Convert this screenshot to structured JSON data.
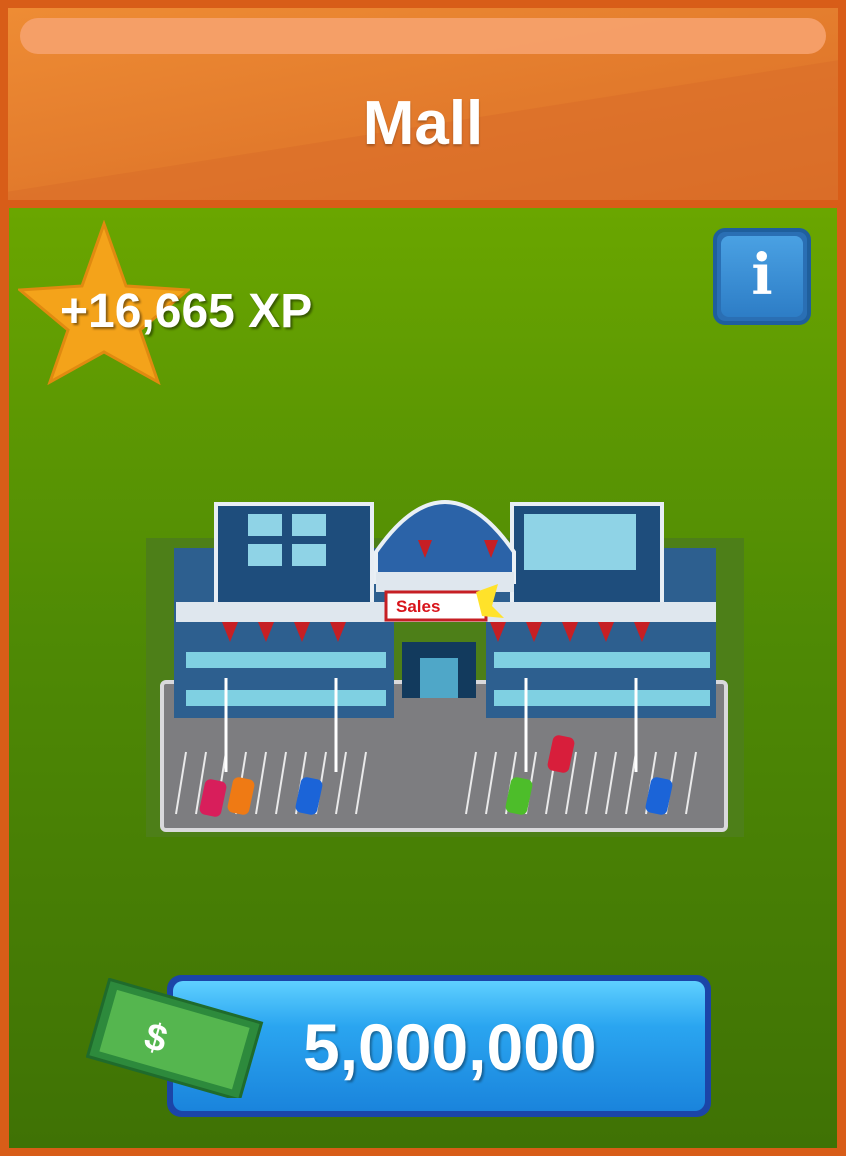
{
  "header": {
    "title": "Mall"
  },
  "reward": {
    "xp_text": "+16,665 XP",
    "badge_icon": "star-icon"
  },
  "info": {
    "icon": "info-icon",
    "glyph": "i"
  },
  "building": {
    "icon": "mall-building-icon",
    "sign_text": "Sales"
  },
  "purchase": {
    "price": "5,000,000",
    "currency_icon": "dollar-bill-icon",
    "currency_symbol": "$"
  },
  "colors": {
    "frame": "#d85d18",
    "header": "#e8842f",
    "field_top": "#6aa600",
    "field_bottom": "#3f7205",
    "button": "#2aa5f0",
    "star": "#f4a31a"
  }
}
